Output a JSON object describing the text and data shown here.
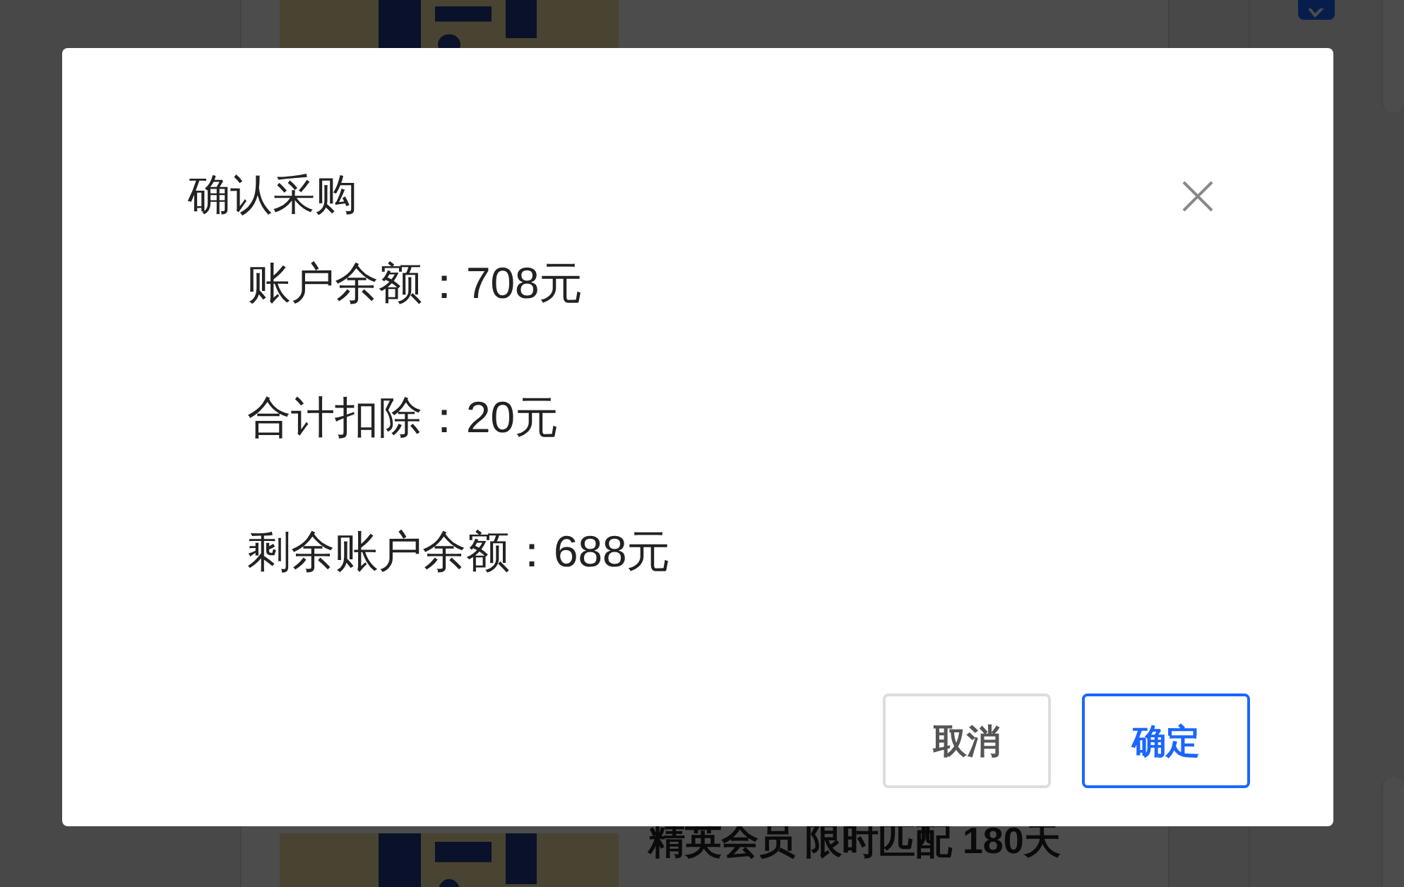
{
  "list": [
    {
      "kind": "picture",
      "checked": true
    },
    {
      "kind": "picture",
      "title": "精英会员 限时匹配 180天"
    }
  ],
  "dialog": {
    "title": "确认采购",
    "lines": [
      "账户余额：708元",
      "合计扣除：20元",
      "剩余账户余额：688元"
    ],
    "buttons": [
      {
        "label": "取消",
        "primary": false
      },
      {
        "label": "确定",
        "primary": true
      }
    ]
  }
}
